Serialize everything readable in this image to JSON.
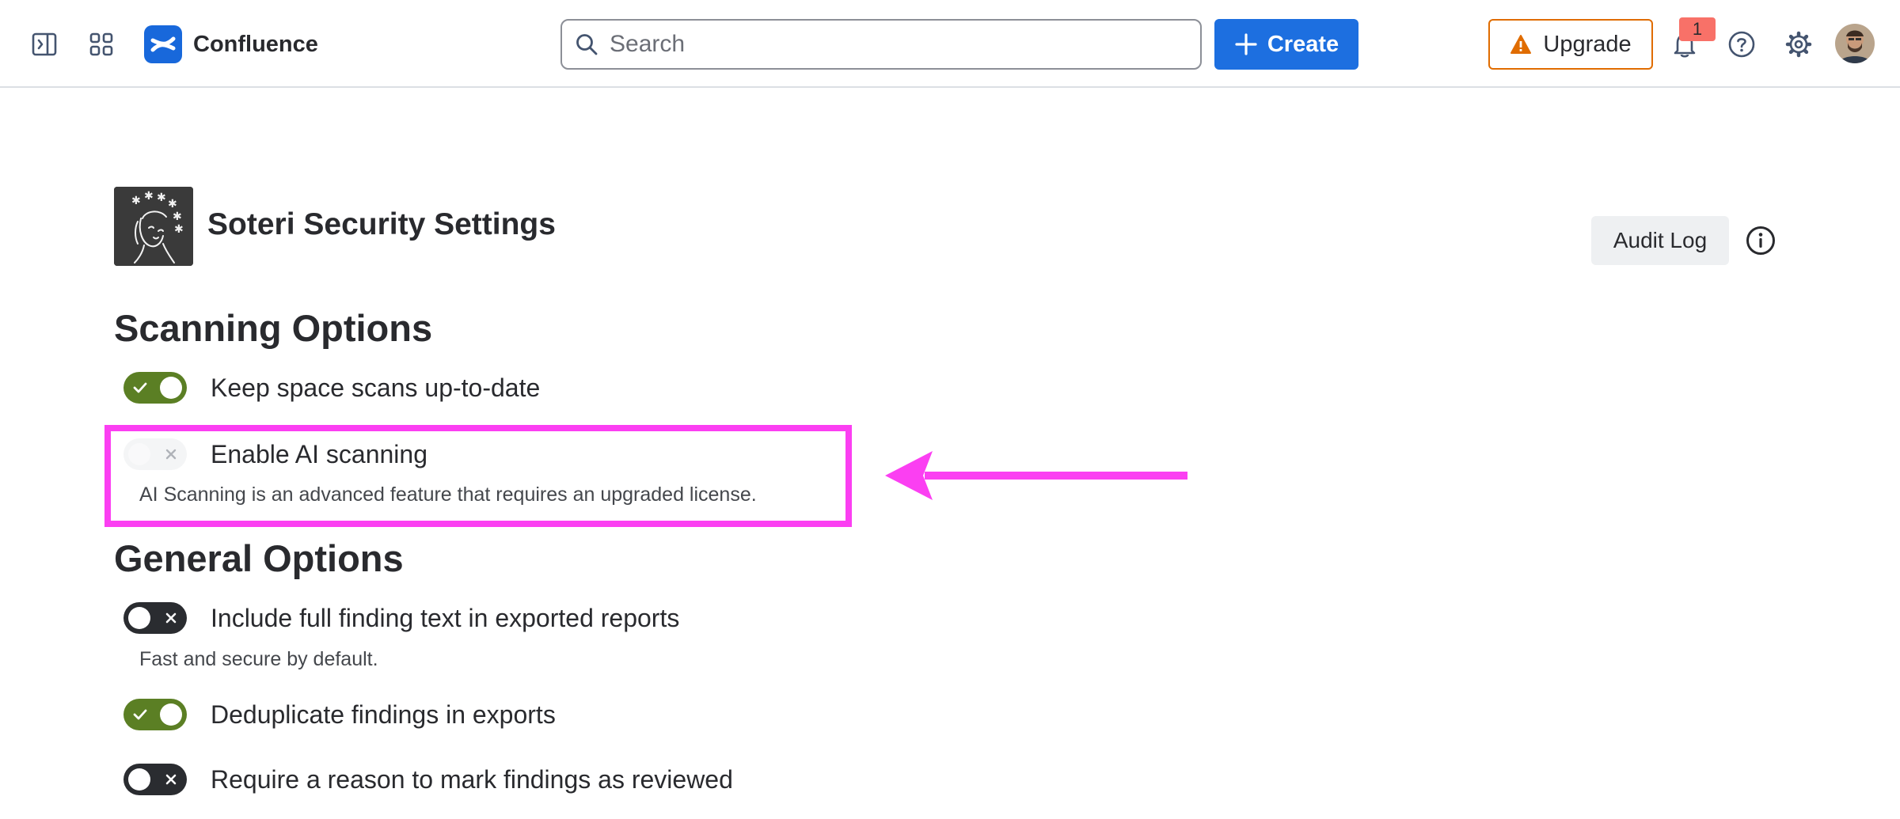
{
  "topbar": {
    "sidebar_toggle_icon": "sidebar-expand-icon",
    "app_switcher_icon": "app-grid-icon",
    "product_name": "Confluence",
    "search_placeholder": "Search",
    "create_label": "Create",
    "upgrade_label": "Upgrade",
    "notification_count": "1",
    "brand_color": "#1868db",
    "create_color": "#1d6fe0",
    "upgrade_border_color": "#e06c00"
  },
  "page": {
    "title": "Soteri Security Settings",
    "audit_log_label": "Audit Log"
  },
  "sections": {
    "scanning": {
      "heading": "Scanning Options",
      "options": [
        {
          "label": "Keep space scans up-to-date",
          "state": "on"
        },
        {
          "label": "Enable AI scanning",
          "state": "disabled",
          "description": "AI Scanning is an advanced feature that requires an upgraded license."
        }
      ]
    },
    "general": {
      "heading": "General Options",
      "options": [
        {
          "label": "Include full finding text in exported reports",
          "state": "off",
          "description": "Fast and secure by default."
        },
        {
          "label": "Deduplicate findings in exports",
          "state": "on"
        },
        {
          "label": "Require a reason to mark findings as reviewed",
          "state": "off"
        }
      ]
    }
  },
  "colors": {
    "toggle_on": "#5b7f24",
    "toggle_off": "#2a2c30",
    "annotation": "#fb3ff2"
  }
}
